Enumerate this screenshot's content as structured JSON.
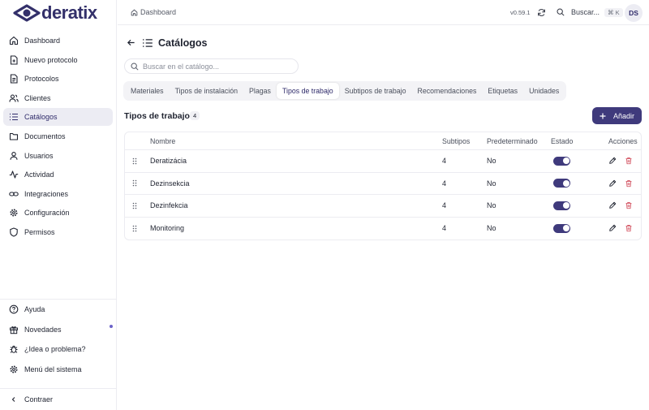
{
  "brand": {
    "name": "deratix",
    "color": "#33306a"
  },
  "colors": {
    "accent": "#3f3a7c",
    "danger": "#d14b5a",
    "active_nav_bg": "#ececf3"
  },
  "sidebar": {
    "items": [
      {
        "label": "Dashboard",
        "icon": "home-icon"
      },
      {
        "label": "Nuevo protocolo",
        "icon": "file-plus-icon"
      },
      {
        "label": "Protocolos",
        "icon": "file-text-icon"
      },
      {
        "label": "Clientes",
        "icon": "users-icon"
      },
      {
        "label": "Catálogos",
        "icon": "list-icon",
        "active": true
      },
      {
        "label": "Documentos",
        "icon": "folder-icon"
      },
      {
        "label": "Usuarios",
        "icon": "user-icon"
      },
      {
        "label": "Actividad",
        "icon": "activity-icon"
      },
      {
        "label": "Integraciones",
        "icon": "link-icon"
      },
      {
        "label": "Configuración",
        "icon": "gear-icon"
      },
      {
        "label": "Permisos",
        "icon": "shield-icon"
      }
    ],
    "bottom": [
      {
        "label": "Ayuda",
        "icon": "help-icon"
      },
      {
        "label": "Novedades",
        "icon": "gift-icon"
      },
      {
        "label": "¿Idea o problema?",
        "icon": "bug-icon"
      },
      {
        "label": "Menú del sistema",
        "icon": "gear-icon"
      }
    ],
    "collapse_label": "Contraer"
  },
  "topbar": {
    "breadcrumb": "Dashboard",
    "version": "v0.59.1",
    "search_label": "Buscar...",
    "shortcut": "⌘ K",
    "avatar": "DS"
  },
  "main": {
    "title": "Catálogos",
    "search_placeholder": "Buscar en el catálogo...",
    "tabs": [
      {
        "label": "Materiales"
      },
      {
        "label": "Tipos de instalación"
      },
      {
        "label": "Plagas"
      },
      {
        "label": "Tipos de trabajo",
        "active": true
      },
      {
        "label": "Subtipos de trabajo"
      },
      {
        "label": "Recomendaciones"
      },
      {
        "label": "Etiquetas"
      },
      {
        "label": "Unidades"
      }
    ],
    "section_title": "Tipos de trabajo",
    "count": "4",
    "add_label": "Añadir",
    "table": {
      "headers": {
        "name": "Nombre",
        "subtipos": "Subtipos",
        "predeterminado": "Predeterminado",
        "estado": "Estado",
        "acciones": "Acciones"
      },
      "rows": [
        {
          "name": "Deratizácia",
          "subtipos": "4",
          "predeterminado": "No",
          "estado": true
        },
        {
          "name": "Dezinsekcia",
          "subtipos": "4",
          "predeterminado": "No",
          "estado": true
        },
        {
          "name": "Dezinfekcia",
          "subtipos": "4",
          "predeterminado": "No",
          "estado": true
        },
        {
          "name": "Monitoring",
          "subtipos": "4",
          "predeterminado": "No",
          "estado": true
        }
      ]
    }
  }
}
